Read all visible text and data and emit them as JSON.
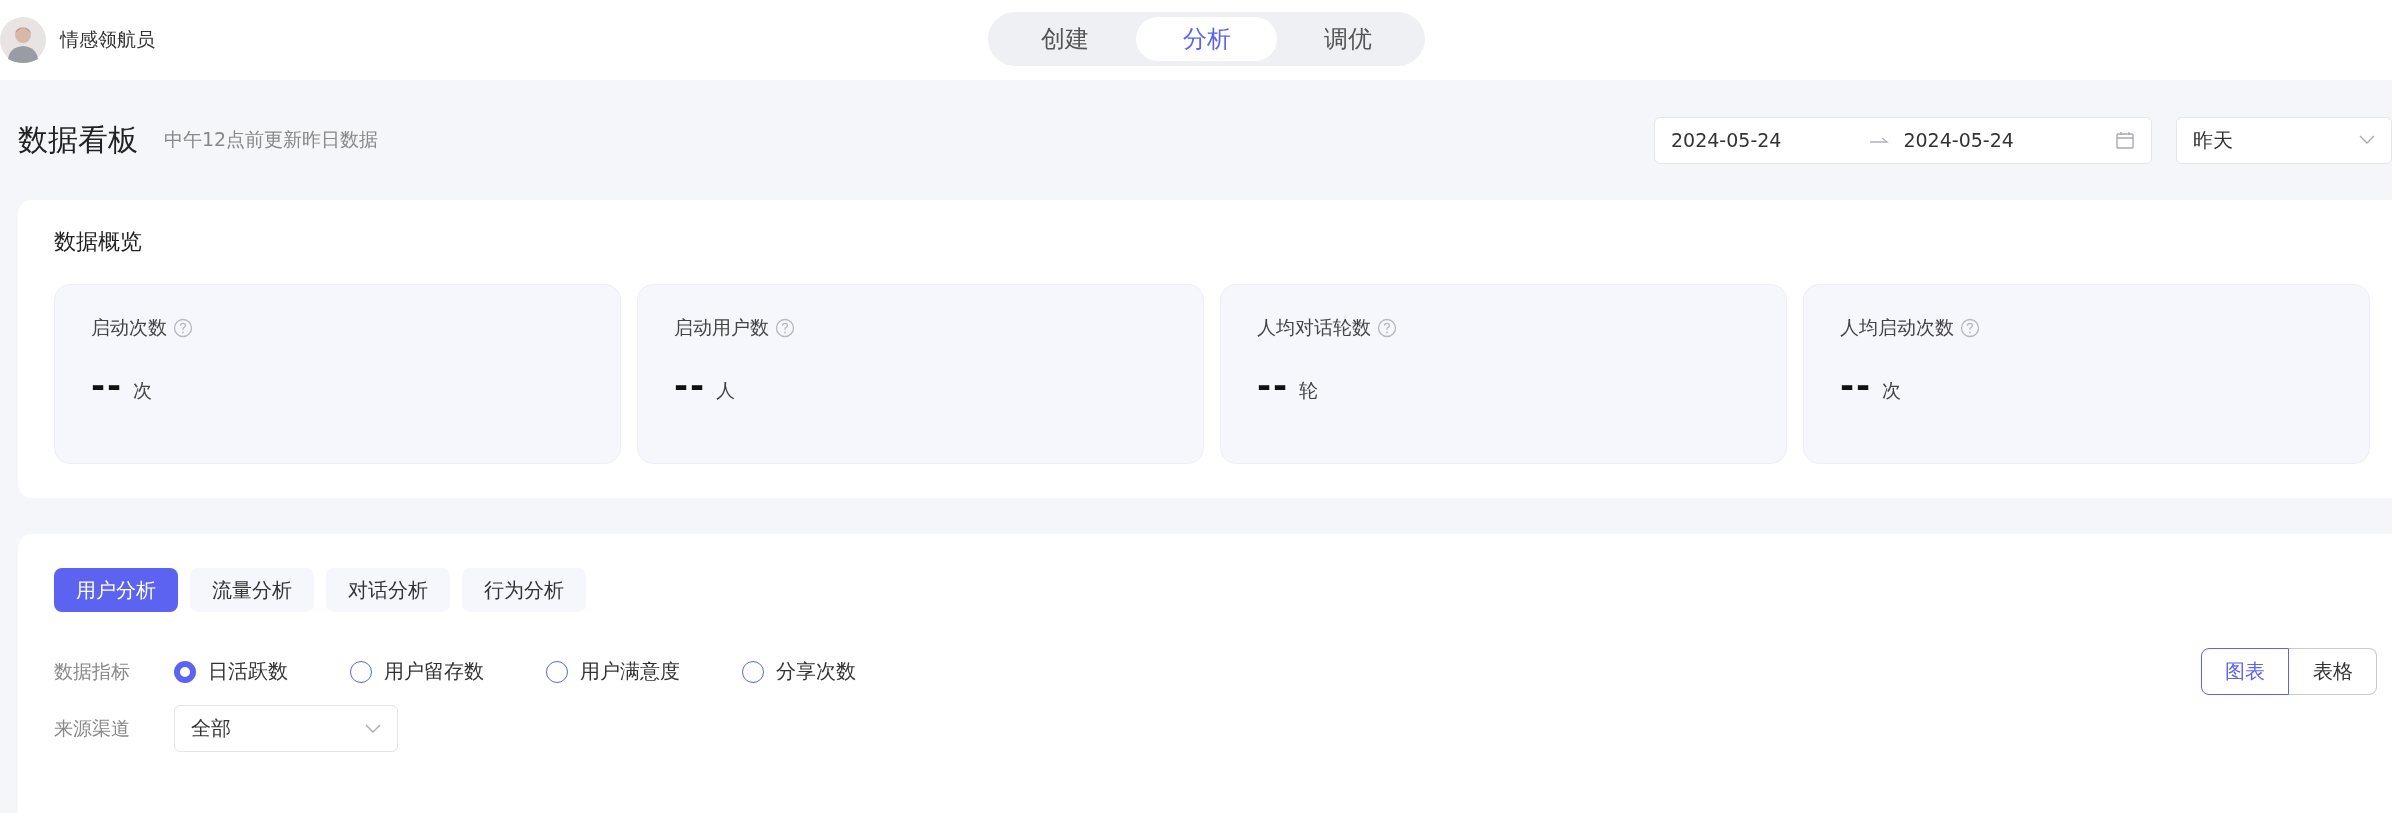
{
  "app": {
    "name": "情感领航员"
  },
  "nav_tabs": [
    {
      "label": "创建",
      "selected": false
    },
    {
      "label": "分析",
      "selected": true
    },
    {
      "label": "调优",
      "selected": false
    }
  ],
  "header": {
    "title": "数据看板",
    "subtitle": "中午12点前更新昨日数据",
    "date_start": "2024-05-24",
    "date_end": "2024-05-24",
    "range": "昨天"
  },
  "overview": {
    "title": "数据概览",
    "metrics": [
      {
        "label": "启动次数",
        "value": "--",
        "unit": "次"
      },
      {
        "label": "启动用户数",
        "value": "--",
        "unit": "人"
      },
      {
        "label": "人均对话轮数",
        "value": "--",
        "unit": "轮"
      },
      {
        "label": "人均启动次数",
        "value": "--",
        "unit": "次"
      }
    ]
  },
  "analysis": {
    "tabs": [
      {
        "label": "用户分析",
        "selected": true
      },
      {
        "label": "流量分析",
        "selected": false
      },
      {
        "label": "对话分析",
        "selected": false
      },
      {
        "label": "行为分析",
        "selected": false
      }
    ],
    "metric_label": "数据指标",
    "metric_options": [
      {
        "label": "日活跃数",
        "selected": true
      },
      {
        "label": "用户留存数",
        "selected": false
      },
      {
        "label": "用户满意度",
        "selected": false
      },
      {
        "label": "分享次数",
        "selected": false
      }
    ],
    "view_toggle": [
      {
        "label": "图表",
        "selected": true
      },
      {
        "label": "表格",
        "selected": false
      }
    ],
    "channel_label": "来源渠道",
    "channel_value": "全部"
  }
}
